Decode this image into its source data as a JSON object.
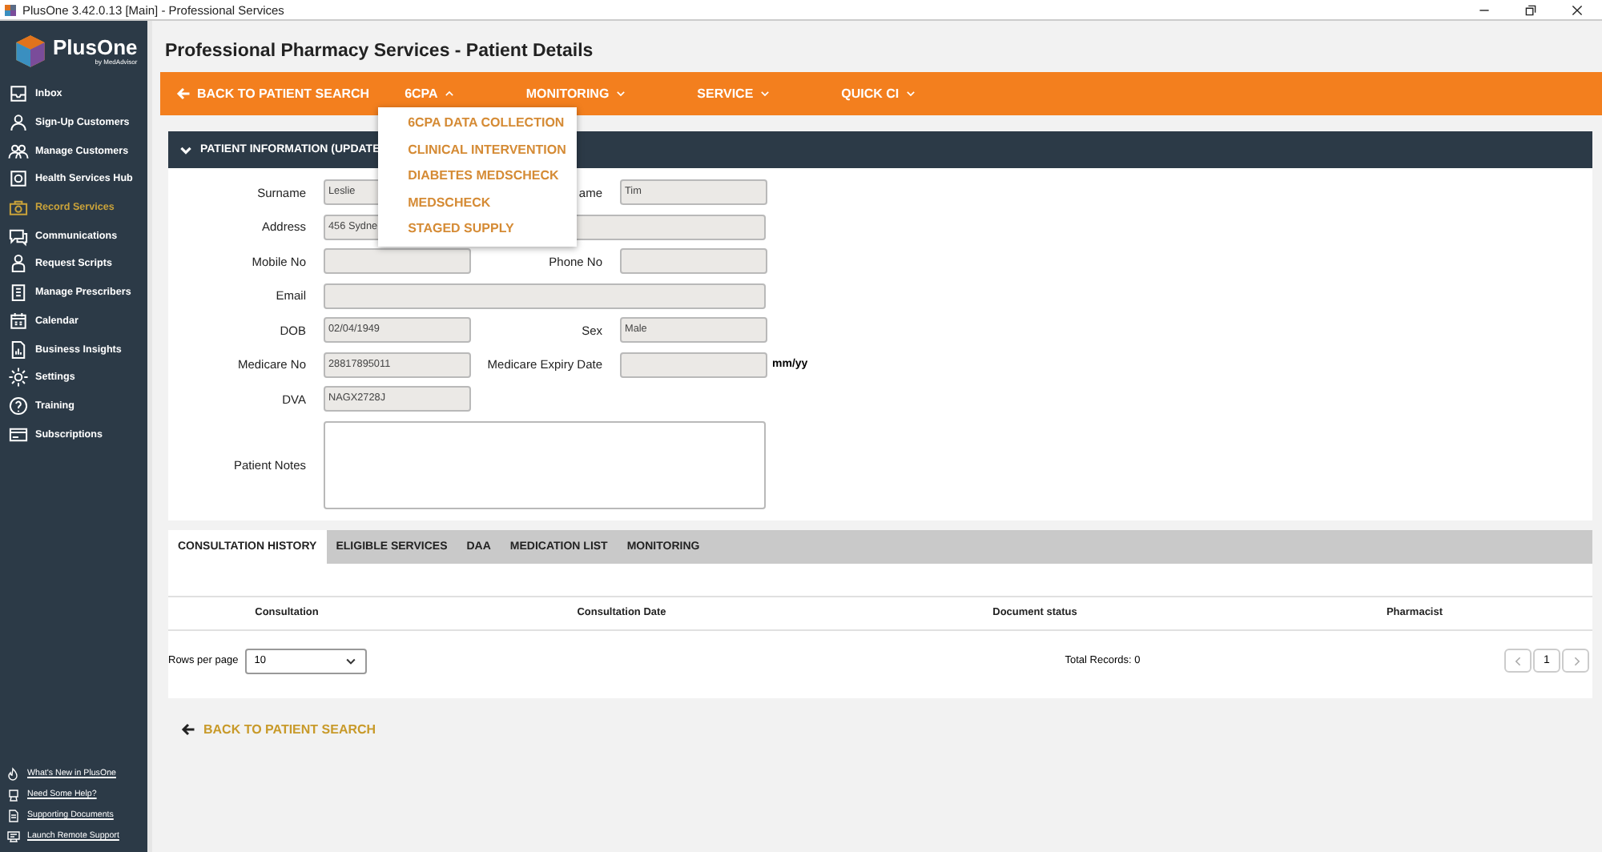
{
  "window": {
    "title": "PlusOne 3.42.0.13 [Main] - Professional Services"
  },
  "sidebar": {
    "logo_text": "PlusOne",
    "logo_sub": "by MedAdvisor",
    "items": [
      {
        "label": "Inbox",
        "selected": false
      },
      {
        "label": "Sign-Up Customers",
        "selected": false
      },
      {
        "label": "Manage Customers",
        "selected": false
      },
      {
        "label": "Health Services Hub",
        "selected": false
      },
      {
        "label": "Record Services",
        "selected": true
      },
      {
        "label": "Communications",
        "selected": false
      },
      {
        "label": "Request Scripts",
        "selected": false
      },
      {
        "label": "Manage Prescribers",
        "selected": false
      },
      {
        "label": "Calendar",
        "selected": false
      },
      {
        "label": "Business Insights",
        "selected": false
      },
      {
        "label": "Settings",
        "selected": false
      },
      {
        "label": "Training",
        "selected": false
      },
      {
        "label": "Subscriptions",
        "selected": false
      }
    ],
    "footer_links": [
      "What's New in PlusOne",
      "Need Some Help?",
      "Supporting Documents",
      "Launch Remote Support"
    ]
  },
  "page_title": "Professional Pharmacy Services - Patient Details",
  "nav": {
    "back": "BACK TO PATIENT SEARCH",
    "menus": [
      {
        "label": "6CPA",
        "expanded": true
      },
      {
        "label": "MONITORING",
        "expanded": false
      },
      {
        "label": "SERVICE",
        "expanded": false
      },
      {
        "label": "QUICK CI",
        "expanded": false
      }
    ],
    "dropdown": [
      "6CPA DATA COLLECTION",
      "CLINICAL INTERVENTION",
      "DIABETES MEDSCHECK",
      "MEDSCHECK",
      "STAGED SUPPLY"
    ]
  },
  "patient_section": {
    "title": "PATIENT INFORMATION (UPDATE",
    "expanded": true,
    "rows": [
      [
        {
          "label": "Surname",
          "value": "Leslie"
        },
        {
          "label": "ame",
          "value": "Tim"
        }
      ],
      [
        {
          "label": "Address",
          "value": "456 Sydne",
          "wide": true
        }
      ],
      [
        {
          "label": "Mobile No"
        },
        {
          "label": "Phone No"
        }
      ],
      [
        {
          "label": "Email",
          "wide": true
        }
      ],
      [
        {
          "label": "DOB",
          "value": "02/04/1949"
        },
        {
          "label": "Sex",
          "value": "Male"
        }
      ],
      [
        {
          "label": "Medicare No",
          "value": "28817895011"
        },
        {
          "label": "Medicare Expiry Date",
          "suffix": "mm/yy"
        }
      ],
      [
        {
          "label": "DVA",
          "value": "NAGX2728J"
        }
      ]
    ],
    "notes_label": "Patient Notes"
  },
  "tabs": [
    {
      "label": "CONSULTATION HISTORY",
      "selected": true
    },
    {
      "label": "ELIGIBLE SERVICES",
      "selected": false
    },
    {
      "label": "DAA",
      "selected": false
    },
    {
      "label": "MEDICATION LIST",
      "selected": false
    },
    {
      "label": "MONITORING",
      "selected": false
    }
  ],
  "table": {
    "columns": [
      "Consultation",
      "Consultation Date",
      "Document status",
      "Pharmacist"
    ]
  },
  "pager": {
    "rows_label": "Rows per page",
    "rows_value": "10",
    "total": "Total Records: 0",
    "page": "1"
  },
  "bottom_back": "BACK TO PATIENT SEARCH"
}
